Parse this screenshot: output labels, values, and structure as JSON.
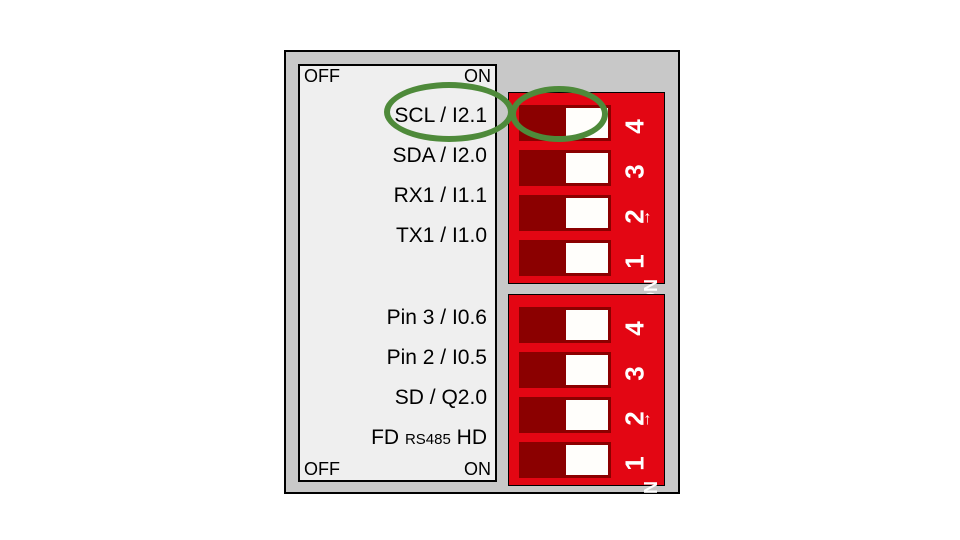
{
  "labels": {
    "off": "OFF",
    "on": "ON",
    "onmark": "ON",
    "arrow": "→"
  },
  "group1": {
    "rows": [
      {
        "text": "SCL / I2.1",
        "num": "4",
        "state": "on"
      },
      {
        "text": "SDA / I2.0",
        "num": "3",
        "state": "on"
      },
      {
        "text": "RX1 / I1.1",
        "num": "2",
        "state": "on"
      },
      {
        "text": "TX1 / I1.0",
        "num": "1",
        "state": "on"
      }
    ]
  },
  "group2": {
    "rows": [
      {
        "text": "Pin 3 / I0.6",
        "num": "4",
        "state": "on"
      },
      {
        "text": "Pin 2 / I0.5",
        "num": "3",
        "state": "on"
      },
      {
        "text": "SD / Q2.0",
        "num": "2",
        "state": "on"
      },
      {
        "num": "1",
        "state": "on"
      }
    ],
    "rs485": {
      "left": "FD",
      "mid": "RS485",
      "right": "HD"
    }
  },
  "highlight": {
    "label_ellipse": true,
    "switch_ellipse": true
  }
}
